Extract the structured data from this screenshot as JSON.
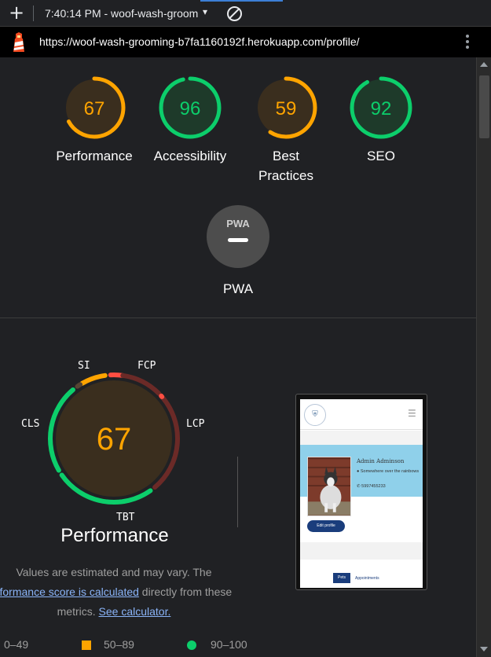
{
  "browser": {
    "new_tab_label": "+",
    "tab_title": "7:40:14 PM - woof-wash-groom",
    "tab_caret": "▾",
    "url": "https://woof-wash-grooming-b7fa1160192f.herokuapp.com/profile/"
  },
  "categories": [
    {
      "id": "performance",
      "score": "67",
      "score_value": 67,
      "lines": [
        "Performance"
      ],
      "color": "#ffa400",
      "bg": "#3a2e1e"
    },
    {
      "id": "accessibility",
      "score": "96",
      "score_value": 96,
      "lines": [
        "Accessibility"
      ],
      "color": "#0cce6b",
      "bg": "#1e3a2a"
    },
    {
      "id": "best-practices",
      "score": "59",
      "score_value": 59,
      "lines": [
        "Best",
        "Practices"
      ],
      "color": "#ffa400",
      "bg": "#3a2e1e"
    },
    {
      "id": "seo",
      "score": "92",
      "score_value": 92,
      "lines": [
        "SEO"
      ],
      "color": "#0cce6b",
      "bg": "#1e3a2a"
    }
  ],
  "pwa": {
    "badge_text": "PWA",
    "label": "PWA"
  },
  "performance": {
    "score": "67",
    "score_value": 67,
    "title": "Performance",
    "metric_labels": {
      "si": "SI",
      "fcp": "FCP",
      "lcp": "LCP",
      "tbt": "TBT",
      "cls": "CLS"
    },
    "note_part1": "Values are estimated and may vary. The",
    "note_link1": "rformance score is calculated",
    "note_part2": " directly from these",
    "note_part3": "metrics. ",
    "note_link2": "See calculator."
  },
  "legend": {
    "fail": "0–49",
    "average": "50–89",
    "pass": "90–100",
    "colors": {
      "fail": "#ff4e42",
      "average": "#ffa400",
      "pass": "#0cce6b"
    }
  },
  "screenshot": {
    "profile_name": "Admin Adminson",
    "address": "Somewhere over the rainbows",
    "phone": "5997455233",
    "edit_button": "Edit profile",
    "tab_pets": "Pets",
    "tab_appointments": "Appointments"
  }
}
